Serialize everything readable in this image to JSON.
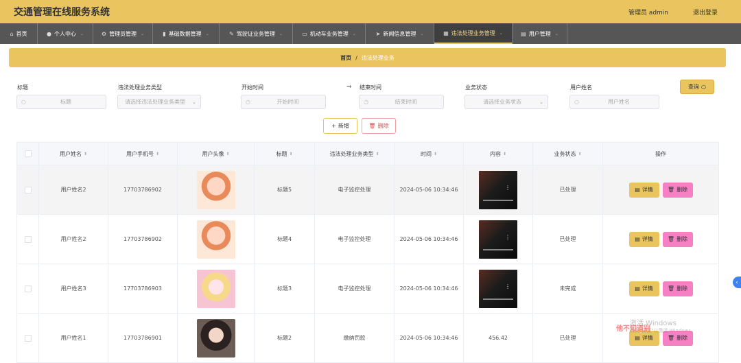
{
  "app": {
    "title": "交通管理在线服务系统",
    "user": "管理员 admin",
    "logout": "退出登录"
  },
  "nav": [
    {
      "label": "首页",
      "icon": "home-icon",
      "glyph": "⌂",
      "dropdown": false
    },
    {
      "label": "个人中心",
      "icon": "user-icon",
      "glyph": "●",
      "dropdown": true
    },
    {
      "label": "管理员管理",
      "icon": "gear-icon",
      "glyph": "⚙",
      "dropdown": true
    },
    {
      "label": "基础数据管理",
      "icon": "chart-icon",
      "glyph": "▮",
      "dropdown": true
    },
    {
      "label": "驾驶证业务管理",
      "icon": "edit-icon",
      "glyph": "✎",
      "dropdown": true
    },
    {
      "label": "机动车业务管理",
      "icon": "monitor-icon",
      "glyph": "▭",
      "dropdown": true
    },
    {
      "label": "新闻信息管理",
      "icon": "send-icon",
      "glyph": "➤",
      "dropdown": true
    },
    {
      "label": "违法处理业务管理",
      "icon": "grid-icon",
      "glyph": "▦",
      "dropdown": true,
      "active": true
    },
    {
      "label": "用户管理",
      "icon": "document-icon",
      "glyph": "▤",
      "dropdown": true
    }
  ],
  "breadcrumb": {
    "home": "首页",
    "sep": "/",
    "current": "违法处理业务"
  },
  "filters": {
    "title": {
      "label": "标题",
      "placeholder": "标题"
    },
    "type": {
      "label": "违法处理业务类型",
      "placeholder": "请选择违法处理业务类型"
    },
    "start": {
      "label": "开始时间",
      "placeholder": "开始时间"
    },
    "end": {
      "label": "结束时间",
      "placeholder": "结束时间"
    },
    "status": {
      "label": "业务状态",
      "placeholder": "请选择业务状态"
    },
    "username": {
      "label": "用户姓名",
      "placeholder": "用户姓名"
    }
  },
  "actions": {
    "search": "查询",
    "add": "新增",
    "delete": "删除"
  },
  "table": {
    "headers": [
      "用户姓名",
      "用户手机号",
      "用户头像",
      "标题",
      "违法处理业务类型",
      "时间",
      "内容",
      "业务状态",
      "操作"
    ],
    "rows": [
      {
        "name": "用户姓名2",
        "phone": "17703786902",
        "avatar": "av1",
        "title": "标题5",
        "type": "电子监控处理",
        "time": "2024-05-06 10:34:46",
        "content": "video",
        "status": "已处理"
      },
      {
        "name": "用户姓名2",
        "phone": "17703786902",
        "avatar": "av1",
        "title": "标题4",
        "type": "电子监控处理",
        "time": "2024-05-06 10:34:46",
        "content": "video",
        "status": "已处理"
      },
      {
        "name": "用户姓名3",
        "phone": "17703786903",
        "avatar": "av2",
        "title": "标题3",
        "type": "电子监控处理",
        "time": "2024-05-06 10:34:46",
        "content": "video",
        "status": "未完成"
      },
      {
        "name": "用户姓名1",
        "phone": "17703786901",
        "avatar": "av3",
        "title": "标题2",
        "type": "缴纳罚款",
        "time": "2024-05-06 10:34:46",
        "content": "456.42",
        "status": "已处理"
      }
    ],
    "op_detail": "详情",
    "op_delete": "删除"
  },
  "watermark": {
    "line1": "激活 Windows",
    "line2": "转到\"设置\"以激活 Windows。",
    "overlay": "他不知道别"
  }
}
